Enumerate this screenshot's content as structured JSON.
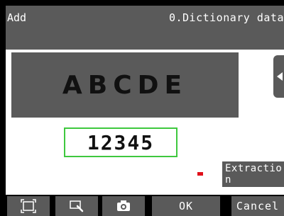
{
  "header": {
    "mode_label": "Add",
    "title": "0.Dictionary data"
  },
  "preview": {
    "text": "ABCDE"
  },
  "input": {
    "value": "12345"
  },
  "buttons": {
    "extraction_label": "Extraction",
    "ok_label": "OK",
    "cancel_label": "Cancel"
  },
  "toolbar_icons": [
    "area-frame-icon",
    "zoom-search-icon",
    "camera-icon"
  ],
  "colors": {
    "panel": "#5a5a5a",
    "box_border": "#3ec83e",
    "marker": "#e0101a"
  }
}
